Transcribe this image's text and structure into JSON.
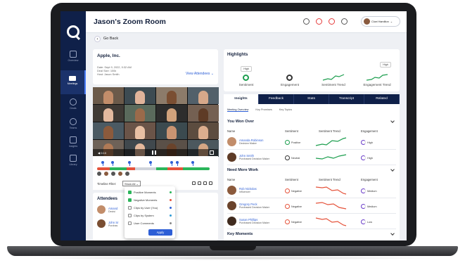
{
  "app": {
    "title": "Jason's Zoom Room",
    "back_label": "Go Back"
  },
  "user": {
    "name": "Cloei Hamilton"
  },
  "sidebar": {
    "items": [
      {
        "label": "Overview",
        "icon": "grid-icon"
      },
      {
        "label": "Meetings",
        "icon": "camera-icon"
      },
      {
        "label": "Deals",
        "icon": "dollar-icon"
      },
      {
        "label": "Teams",
        "icon": "team-icon"
      },
      {
        "label": "Insights",
        "icon": "document-icon"
      },
      {
        "label": "Library",
        "icon": "library-icon"
      }
    ]
  },
  "meeting": {
    "company": "Apple, Inc.",
    "date": "Date: Sept 9, 2022, 9:32 AM",
    "deal_size": "Deal Size: 100k",
    "host": "Host: Jason Smith",
    "view_attendees": "View Attendees"
  },
  "video": {
    "time": "0:10"
  },
  "timeline": {
    "filter_label": "Timeline Filter:",
    "filter_value": "Show All"
  },
  "filter_menu": {
    "options": [
      {
        "label": "Positive Moments",
        "checked": true,
        "color": "#2bb55a"
      },
      {
        "label": "Negative Moments",
        "checked": true,
        "color": "#e5533b"
      },
      {
        "label": "Clips by User (You)",
        "checked": false,
        "color": "#2e5fd6"
      },
      {
        "label": "Clips by System",
        "checked": false,
        "color": "#2e9bd6"
      },
      {
        "label": "User Comments",
        "checked": false,
        "color": "#888888"
      }
    ],
    "apply": "Apply"
  },
  "attendees": {
    "title": "Attendees",
    "rows": [
      {
        "name": "Amand",
        "role": "Decisi"
      },
      {
        "name": "John Sr",
        "role": "Purchas"
      }
    ]
  },
  "highlights": {
    "title": "Highlights",
    "items": [
      {
        "label": "Sentiment",
        "badge": "High"
      },
      {
        "label": "Engagement",
        "badge": ""
      },
      {
        "label": "Sentiment Trend",
        "badge": ""
      },
      {
        "label": "Engagement Trend",
        "badge": "High"
      }
    ]
  },
  "tabs": [
    "Insights",
    "Feedback",
    "Stats",
    "Transcript",
    "Related"
  ],
  "subtabs": [
    "Meeting Overview",
    "Key Promises",
    "Key Topics"
  ],
  "columns": {
    "name": "Name",
    "sentiment": "Sentiment",
    "trend": "Sentiment Trend",
    "engagement": "Engagement"
  },
  "sections": [
    {
      "title": "You Won Over",
      "rows": [
        {
          "name": "Amanda Robinson",
          "role": "Decision Maker",
          "sentiment": "Positive",
          "engagement": "High"
        },
        {
          "name": "John Smith",
          "role": "Purchased Decision Maker",
          "sentiment": "Neutral",
          "engagement": "High"
        }
      ]
    },
    {
      "title": "Need More Work",
      "rows": [
        {
          "name": "Rob Nickolas",
          "role": "Influencer",
          "sentiment": "Negative",
          "engagement": "Medium"
        },
        {
          "name": "Gregory Peck",
          "role": "Purchased Decision Maker",
          "sentiment": "Negative",
          "engagement": "Medium"
        },
        {
          "name": "Susan Phillips",
          "role": "Purchased Decision Maker",
          "sentiment": "Negative",
          "engagement": "Low"
        }
      ]
    },
    {
      "title": "Key Moments",
      "rows": []
    }
  ],
  "colors": {
    "navy": "#0f2049",
    "accent": "#2e5fd6",
    "positive": "#1c9e4e",
    "negative": "#e5533b",
    "neutral": "#333333"
  }
}
